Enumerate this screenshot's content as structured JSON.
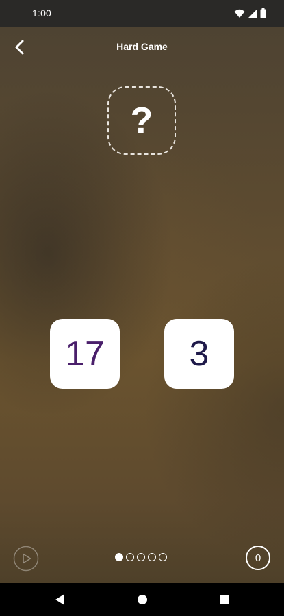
{
  "status_bar": {
    "time": "1:00",
    "icons": [
      "wifi-icon",
      "signal-icon",
      "battery-icon"
    ]
  },
  "header": {
    "title": "Hard Game",
    "back_icon": "chevron-left-icon"
  },
  "question": {
    "symbol": "?"
  },
  "cards": [
    {
      "value": "17",
      "color": "#4a1f6b"
    },
    {
      "value": "3",
      "color": "#1f1a4a"
    }
  ],
  "footer": {
    "play_icon": "play-icon",
    "progress": {
      "total": 5,
      "current": 1
    },
    "score": "0"
  },
  "nav_bar": {
    "icons": [
      "back-triangle-icon",
      "home-circle-icon",
      "recents-square-icon"
    ]
  },
  "colors": {
    "status_bar_bg": "#2a2927",
    "nav_bar_bg": "#000000",
    "card_bg": "#ffffff"
  }
}
